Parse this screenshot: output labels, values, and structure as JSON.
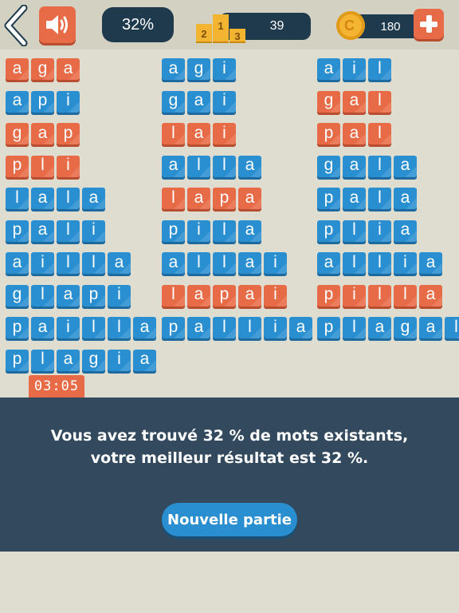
{
  "header": {
    "percent": "32%",
    "rank_score": "39",
    "podium": [
      "2",
      "1",
      "3"
    ],
    "coins": "180",
    "icons": {
      "back": "chevron-left-icon",
      "sound": "speaker-icon",
      "rank": "podium-icon",
      "coin": "coin-icon",
      "add": "plus-icon"
    }
  },
  "colors": {
    "found": "#2a8fd0",
    "not_found": "#e86b47",
    "panel": "#334a5e",
    "pill": "#1f3a4d"
  },
  "words": [
    {
      "text": "aga",
      "found": false
    },
    {
      "text": "agi",
      "found": true
    },
    {
      "text": "ail",
      "found": true
    },
    {
      "text": "api",
      "found": true
    },
    {
      "text": "gai",
      "found": true
    },
    {
      "text": "gal",
      "found": false
    },
    {
      "text": "gap",
      "found": false
    },
    {
      "text": "lai",
      "found": false
    },
    {
      "text": "pal",
      "found": false
    },
    {
      "text": "pli",
      "found": false
    },
    {
      "text": "alla",
      "found": true
    },
    {
      "text": "gala",
      "found": true
    },
    {
      "text": "lala",
      "found": true
    },
    {
      "text": "lapa",
      "found": false
    },
    {
      "text": "pala",
      "found": true
    },
    {
      "text": "pali",
      "found": true
    },
    {
      "text": "pila",
      "found": true
    },
    {
      "text": "plia",
      "found": true
    },
    {
      "text": "ailla",
      "found": true
    },
    {
      "text": "allai",
      "found": true
    },
    {
      "text": "allia",
      "found": true
    },
    {
      "text": "glapi",
      "found": true
    },
    {
      "text": "lapai",
      "found": false
    },
    {
      "text": "pilla",
      "found": false
    },
    {
      "text": "pailla",
      "found": true
    },
    {
      "text": "pallia",
      "found": true
    },
    {
      "text": "plagal",
      "found": true
    },
    {
      "text": "plagia",
      "found": true
    }
  ],
  "timer": "03:05",
  "result": {
    "message": "Vous avez trouvé 32 % de mots existants, votre meilleur résultat est 32 %.",
    "button_label": "Nouvelle partie"
  }
}
